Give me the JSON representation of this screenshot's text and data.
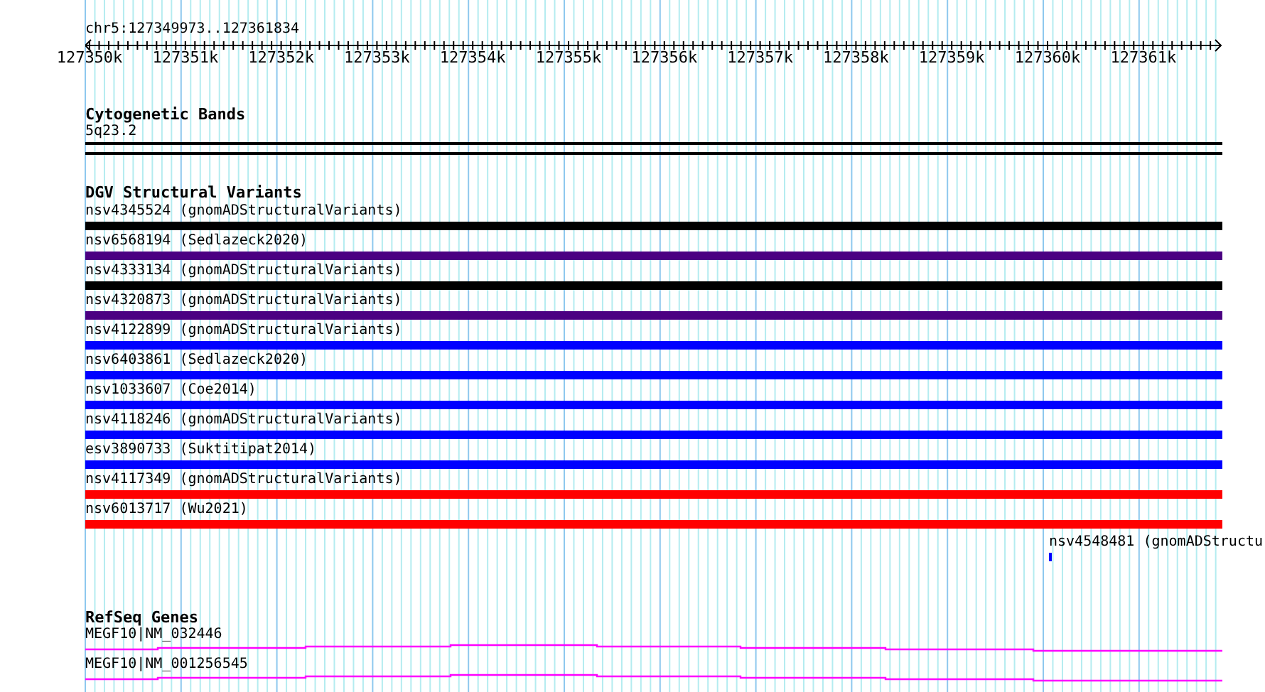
{
  "location": "chr5:127349973..127361834",
  "ruler": {
    "ticks": [
      "127350k",
      "127351k",
      "127352k",
      "127353k",
      "127354k",
      "127355k",
      "127356k",
      "127357k",
      "127358k",
      "127359k",
      "127360k",
      "127361k"
    ]
  },
  "tracks": [
    {
      "kind": "bands",
      "title": "Cytogenetic Bands",
      "features": [
        {
          "label": "5q23.2"
        }
      ]
    },
    {
      "kind": "variants",
      "title": "DGV Structural Variants",
      "features": [
        {
          "label": "nsv4345524 (gnomADStructuralVariants)",
          "color": "#000000"
        },
        {
          "label": "nsv6568194 (Sedlazeck2020)",
          "color": "#4b0082"
        },
        {
          "label": "nsv4333134 (gnomADStructuralVariants)",
          "color": "#000000"
        },
        {
          "label": "nsv4320873 (gnomADStructuralVariants)",
          "color": "#4b0082"
        },
        {
          "label": "nsv4122899 (gnomADStructuralVariants)",
          "color": "#0000ff"
        },
        {
          "label": "nsv6403861 (Sedlazeck2020)",
          "color": "#0000ff"
        },
        {
          "label": "nsv1033607 (Coe2014)",
          "color": "#0000ff"
        },
        {
          "label": "nsv4118246 (gnomADStructuralVariants)",
          "color": "#0000ff"
        },
        {
          "label": "esv3890733 (Suktitipat2014)",
          "color": "#0000ff"
        },
        {
          "label": "nsv4117349 (gnomADStructuralVariants)",
          "color": "#ff0000"
        },
        {
          "label": "nsv6013717 (Wu2021)",
          "color": "#ff0000"
        }
      ],
      "small_features": [
        {
          "label": "nsv4548481 (gnomADStructu",
          "color": "#0000ff"
        }
      ]
    },
    {
      "kind": "genes",
      "title": "RefSeq Genes",
      "features": [
        {
          "label": "MEGF10|NM_032446"
        },
        {
          "label": "MEGF10|NM_001256545"
        }
      ]
    }
  ]
}
